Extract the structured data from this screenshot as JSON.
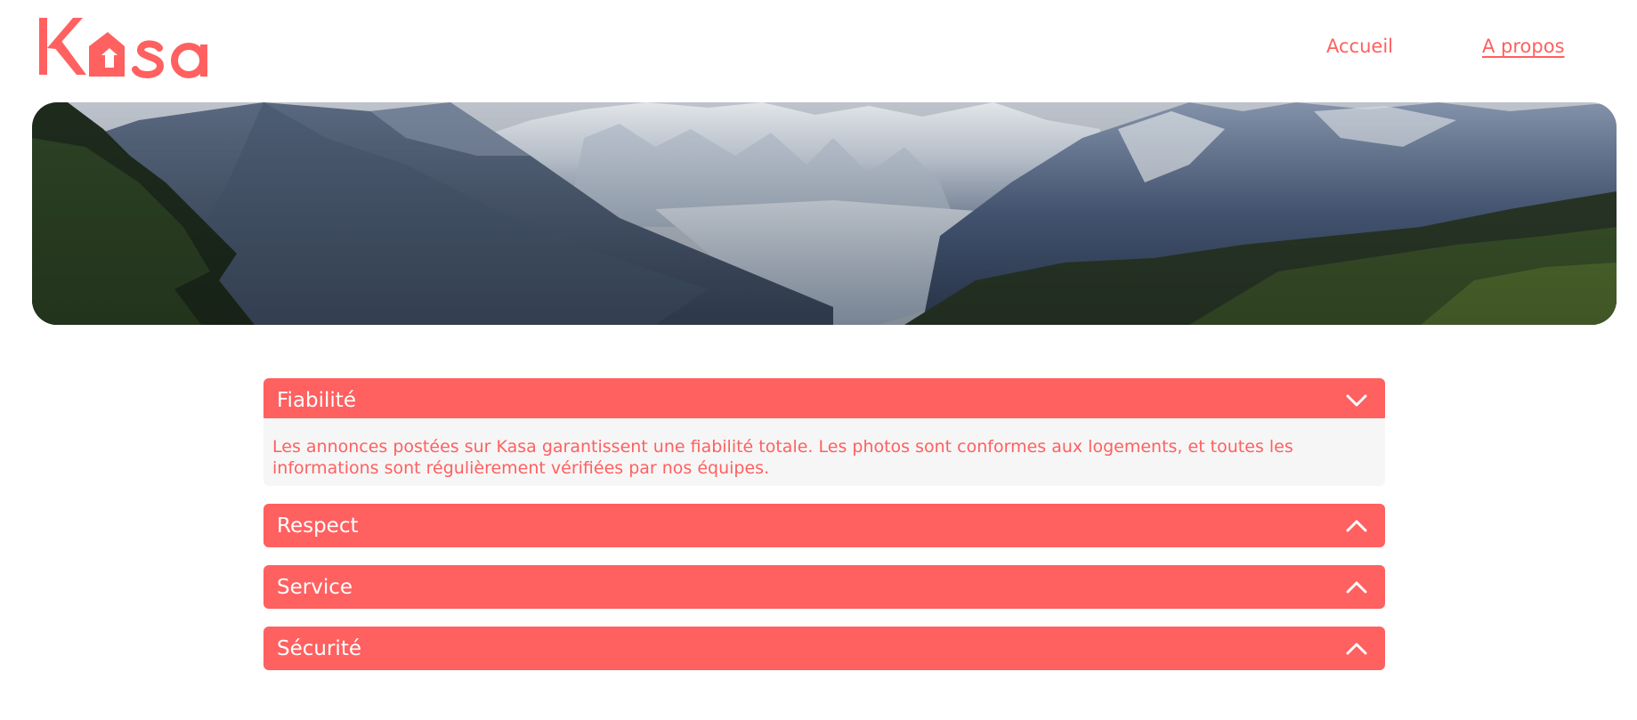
{
  "brand": {
    "logo_text": "Kasa",
    "color": "#ff6060"
  },
  "nav": {
    "home_label": "Accueil",
    "about_label": "A propos"
  },
  "banner": {
    "image_subject": "mountain-valley-landscape"
  },
  "collapses": [
    {
      "title": "Fiabilité",
      "expanded": true,
      "chevron": "chevron-down-icon",
      "content": "Les annonces postées sur Kasa garantissent une fiabilité totale. Les photos sont conformes aux logements, et toutes les informations sont régulièrement vérifiées par nos équipes."
    },
    {
      "title": "Respect",
      "expanded": false,
      "chevron": "chevron-up-icon"
    },
    {
      "title": "Service",
      "expanded": false,
      "chevron": "chevron-up-icon"
    },
    {
      "title": "Sécurité",
      "expanded": false,
      "chevron": "chevron-up-icon"
    }
  ]
}
